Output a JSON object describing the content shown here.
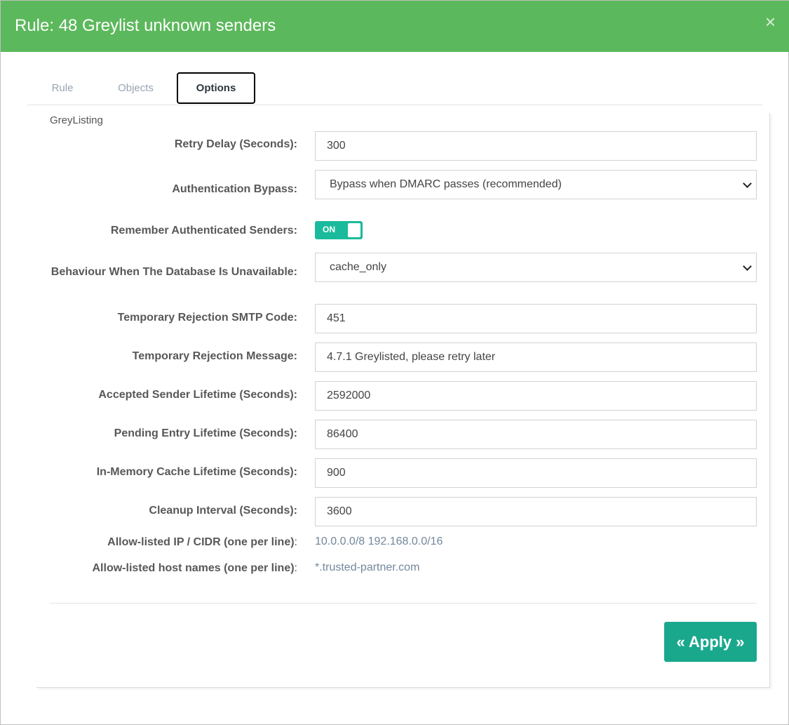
{
  "modal": {
    "title": "Rule: 48 Greylist unknown senders",
    "close_symbol": "×"
  },
  "tabs": [
    {
      "label": "Rule",
      "active": false
    },
    {
      "label": "Objects",
      "active": false
    },
    {
      "label": "Options",
      "active": true
    }
  ],
  "section": {
    "title": "GreyListing"
  },
  "fields": {
    "retry_delay": {
      "label": "Retry Delay (Seconds):",
      "value": "300"
    },
    "auth_bypass": {
      "label": "Authentication Bypass:",
      "value": "Bypass when DMARC passes (recommended)"
    },
    "remember_senders": {
      "label": "Remember Authenticated Senders:",
      "toggle_text": "ON",
      "enabled": true
    },
    "db_unavailable": {
      "label": "Behaviour When The Database Is Unavailable:",
      "value": "cache_only"
    },
    "smtp_code": {
      "label": "Temporary Rejection SMTP Code:",
      "value": "451"
    },
    "rejection_message": {
      "label": "Temporary Rejection Message:",
      "value": "4.7.1 Greylisted, please retry later"
    },
    "accepted_lifetime": {
      "label": "Accepted Sender Lifetime (Seconds):",
      "value": "2592000"
    },
    "pending_lifetime": {
      "label": "Pending Entry Lifetime (Seconds):",
      "value": "86400"
    },
    "cache_lifetime": {
      "label": "In-Memory Cache Lifetime (Seconds):",
      "value": "900"
    },
    "cleanup_interval": {
      "label": "Cleanup Interval (Seconds):",
      "value": "3600"
    },
    "allow_ips": {
      "label": "Allow-listed IP / CIDR (one per line)",
      "colon": ":",
      "value": "10.0.0.0/8 192.168.0.0/16"
    },
    "allow_hosts": {
      "label": "Allow-listed host names (one per line)",
      "colon": ":",
      "value": "*.trusted-partner.com"
    }
  },
  "actions": {
    "apply_label": "« Apply »"
  },
  "colors": {
    "header": "#5cb85c",
    "accent": "#1aa88d",
    "toggle": "#1abb9c"
  }
}
